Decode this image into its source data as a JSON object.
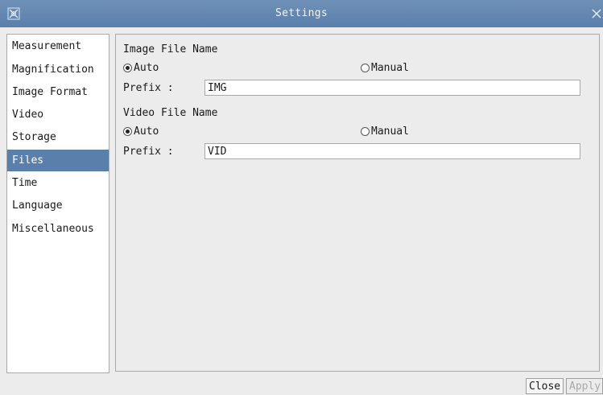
{
  "window": {
    "title": "Settings"
  },
  "sidebar": {
    "items": [
      {
        "label": "Measurement"
      },
      {
        "label": "Magnification"
      },
      {
        "label": "Image Format"
      },
      {
        "label": "Video"
      },
      {
        "label": "Storage"
      },
      {
        "label": "Files",
        "selected": true
      },
      {
        "label": "Time"
      },
      {
        "label": "Language"
      },
      {
        "label": "Miscellaneous"
      }
    ]
  },
  "image_file_name": {
    "title": "Image File Name",
    "auto_label": "Auto",
    "manual_label": "Manual",
    "selected": "Auto",
    "prefix_label": "Prefix :",
    "prefix_value": "IMG"
  },
  "video_file_name": {
    "title": "Video File Name",
    "auto_label": "Auto",
    "manual_label": "Manual",
    "selected": "Auto",
    "prefix_label": "Prefix :",
    "prefix_value": "VID"
  },
  "buttons": {
    "close_label": "Close",
    "apply_label": "Apply"
  },
  "colors": {
    "titlebar": "#5a7fab",
    "selection": "#5a7fab"
  },
  "icons": {
    "app": "app-icon",
    "close": "close-icon"
  }
}
